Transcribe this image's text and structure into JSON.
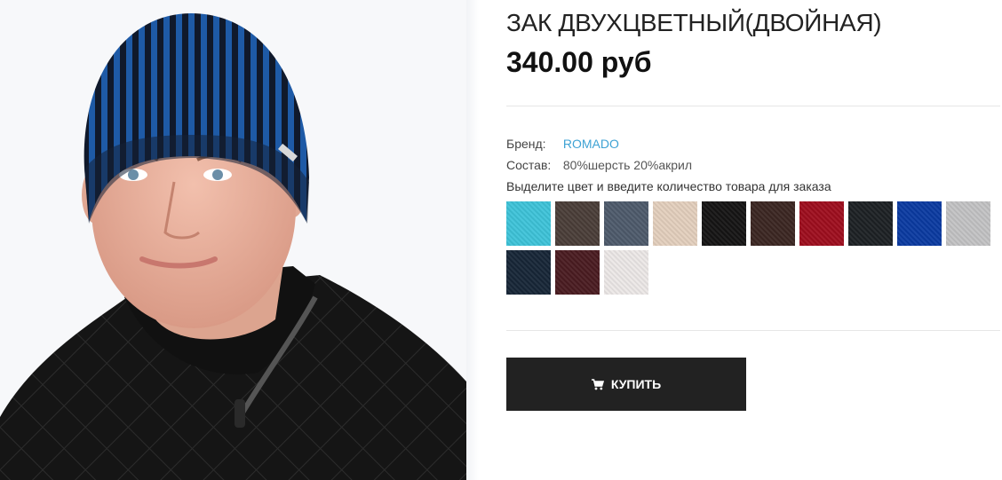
{
  "product": {
    "title": "ЗАК ДВУХЦВЕТНЫЙ(ДВОЙНАЯ)",
    "price": "340.00 руб"
  },
  "attributes": {
    "brand_label": "Бренд:",
    "brand_value": "ROMADO",
    "composition_label": "Состав:",
    "composition_value": "80%шерсть 20%акрил"
  },
  "color_hint": "Выделите цвет и введите количество товара для заказа",
  "colors": [
    {
      "hex": "#3ec3d9"
    },
    {
      "hex": "#4a3e38"
    },
    {
      "hex": "#4e5a6b"
    },
    {
      "hex": "#e3cfbd"
    },
    {
      "hex": "#151414"
    },
    {
      "hex": "#3b2622"
    },
    {
      "hex": "#9e0e1e"
    },
    {
      "hex": "#1d2124"
    },
    {
      "hex": "#0b3aa1"
    },
    {
      "hex": "#c2c2c4"
    },
    {
      "hex": "#172637"
    },
    {
      "hex": "#4a1c21"
    },
    {
      "hex": "#ece8e7"
    }
  ],
  "buy_button": {
    "label": "КУПИТЬ",
    "icon": "shopping-cart-icon"
  }
}
